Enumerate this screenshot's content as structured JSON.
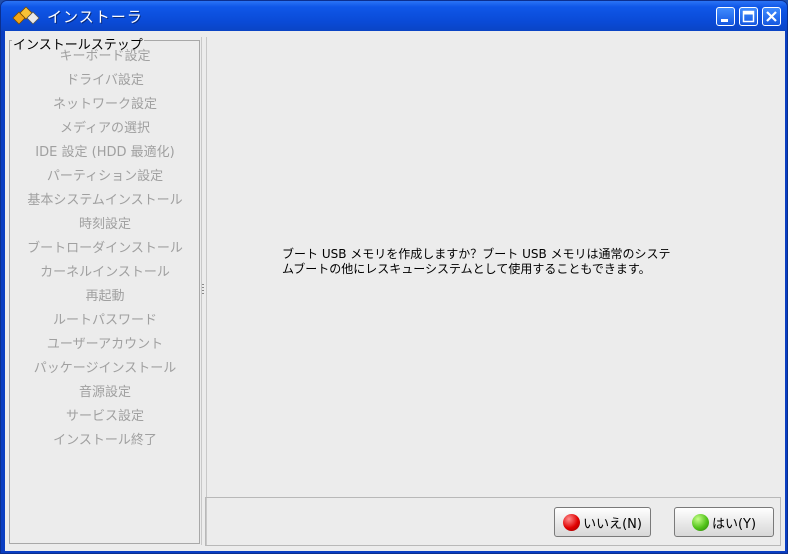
{
  "window": {
    "title": "インストーラ"
  },
  "icons": {
    "app": "installer-diamonds-icon",
    "minimize": "minimize-icon",
    "maximize": "maximize-icon",
    "close": "close-icon",
    "no": "red-circle-icon",
    "yes": "green-circle-icon"
  },
  "steps": {
    "legend": "インストールステップ",
    "items": [
      "キーボード設定",
      "ドライバ設定",
      "ネットワーク設定",
      "メディアの選択",
      "IDE 設定 (HDD 最適化)",
      "パーティション設定",
      "基本システムインストール",
      "時刻設定",
      "ブートローダインストール",
      "カーネルインストール",
      "再起動",
      "ルートパスワード",
      "ユーザーアカウント",
      "パッケージインストール",
      "音源設定",
      "サービス設定",
      "インストール終了"
    ]
  },
  "main": {
    "message": "ブート USB メモリを作成しますか？ブート USB メモリは通常のシステ\nムブートの他にレスキューシステムとして使用することもできます。"
  },
  "buttons": {
    "no_label": "いいえ(N)",
    "yes_label": "はい(Y)"
  }
}
